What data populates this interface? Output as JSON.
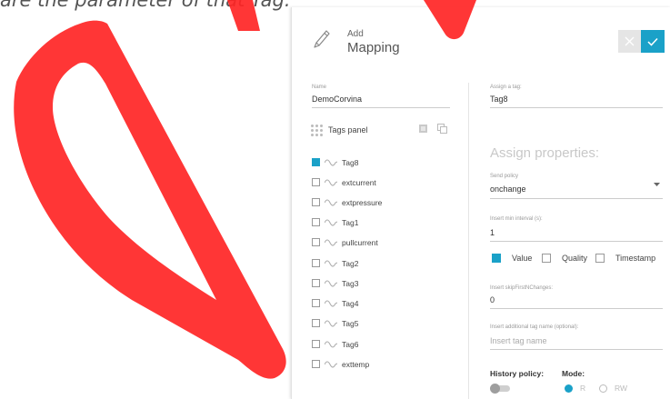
{
  "background_text": "are the parameter of that Tag.",
  "header": {
    "small_label": "Add",
    "title": "Mapping"
  },
  "colors": {
    "accent": "#1aa1c8",
    "annotation": "#ff0000"
  },
  "left": {
    "name_label": "Name",
    "name_value": "DemoCorvina",
    "tags_panel_label": "Tags panel",
    "tags": [
      {
        "name": "Tag8",
        "checked": true
      },
      {
        "name": "extcurrent",
        "checked": false
      },
      {
        "name": "extpressure",
        "checked": false
      },
      {
        "name": "Tag1",
        "checked": false
      },
      {
        "name": "pullcurrent",
        "checked": false
      },
      {
        "name": "Tag2",
        "checked": false
      },
      {
        "name": "Tag3",
        "checked": false
      },
      {
        "name": "Tag4",
        "checked": false
      },
      {
        "name": "Tag5",
        "checked": false
      },
      {
        "name": "Tag6",
        "checked": false
      },
      {
        "name": "exttemp",
        "checked": false
      }
    ]
  },
  "right": {
    "assign_tag_label": "Assign a tag:",
    "assign_tag_value": "Tag8",
    "assign_properties_title": "Assign properties:",
    "send_policy_label": "Send policy",
    "send_policy_value": "onchange",
    "insert_min_interval_label": "Insert min interval (s):",
    "insert_min_interval_value": "1",
    "checkboxes": [
      {
        "label": "Value",
        "checked": true
      },
      {
        "label": "Quality",
        "checked": false
      },
      {
        "label": "Timestamp",
        "checked": false
      }
    ],
    "skip_label": "Insert skipFirstNChanges:",
    "skip_value": "0",
    "additional_tag_label": "Insert additional tag name (optional):",
    "additional_tag_placeholder": "Insert tag name",
    "history_policy_label": "History policy:",
    "history_policy_on": false,
    "mode_label": "Mode:",
    "mode_options": [
      {
        "label": "R",
        "selected": true
      },
      {
        "label": "RW",
        "selected": false
      }
    ]
  }
}
